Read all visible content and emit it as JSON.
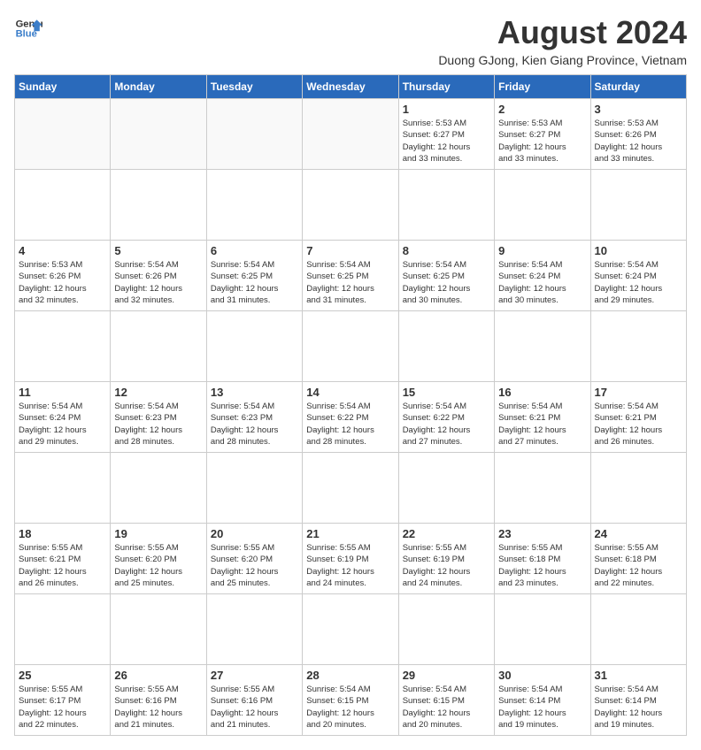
{
  "logo": {
    "line1": "General",
    "line2": "Blue"
  },
  "title": "August 2024",
  "subtitle": "Duong GJong, Kien Giang Province, Vietnam",
  "days_of_week": [
    "Sunday",
    "Monday",
    "Tuesday",
    "Wednesday",
    "Thursday",
    "Friday",
    "Saturday"
  ],
  "weeks": [
    {
      "days": [
        {
          "num": "",
          "info": ""
        },
        {
          "num": "",
          "info": ""
        },
        {
          "num": "",
          "info": ""
        },
        {
          "num": "",
          "info": ""
        },
        {
          "num": "1",
          "info": "Sunrise: 5:53 AM\nSunset: 6:27 PM\nDaylight: 12 hours\nand 33 minutes."
        },
        {
          "num": "2",
          "info": "Sunrise: 5:53 AM\nSunset: 6:27 PM\nDaylight: 12 hours\nand 33 minutes."
        },
        {
          "num": "3",
          "info": "Sunrise: 5:53 AM\nSunset: 6:26 PM\nDaylight: 12 hours\nand 33 minutes."
        }
      ]
    },
    {
      "days": [
        {
          "num": "4",
          "info": "Sunrise: 5:53 AM\nSunset: 6:26 PM\nDaylight: 12 hours\nand 32 minutes."
        },
        {
          "num": "5",
          "info": "Sunrise: 5:54 AM\nSunset: 6:26 PM\nDaylight: 12 hours\nand 32 minutes."
        },
        {
          "num": "6",
          "info": "Sunrise: 5:54 AM\nSunset: 6:25 PM\nDaylight: 12 hours\nand 31 minutes."
        },
        {
          "num": "7",
          "info": "Sunrise: 5:54 AM\nSunset: 6:25 PM\nDaylight: 12 hours\nand 31 minutes."
        },
        {
          "num": "8",
          "info": "Sunrise: 5:54 AM\nSunset: 6:25 PM\nDaylight: 12 hours\nand 30 minutes."
        },
        {
          "num": "9",
          "info": "Sunrise: 5:54 AM\nSunset: 6:24 PM\nDaylight: 12 hours\nand 30 minutes."
        },
        {
          "num": "10",
          "info": "Sunrise: 5:54 AM\nSunset: 6:24 PM\nDaylight: 12 hours\nand 29 minutes."
        }
      ]
    },
    {
      "days": [
        {
          "num": "11",
          "info": "Sunrise: 5:54 AM\nSunset: 6:24 PM\nDaylight: 12 hours\nand 29 minutes."
        },
        {
          "num": "12",
          "info": "Sunrise: 5:54 AM\nSunset: 6:23 PM\nDaylight: 12 hours\nand 28 minutes."
        },
        {
          "num": "13",
          "info": "Sunrise: 5:54 AM\nSunset: 6:23 PM\nDaylight: 12 hours\nand 28 minutes."
        },
        {
          "num": "14",
          "info": "Sunrise: 5:54 AM\nSunset: 6:22 PM\nDaylight: 12 hours\nand 28 minutes."
        },
        {
          "num": "15",
          "info": "Sunrise: 5:54 AM\nSunset: 6:22 PM\nDaylight: 12 hours\nand 27 minutes."
        },
        {
          "num": "16",
          "info": "Sunrise: 5:54 AM\nSunset: 6:21 PM\nDaylight: 12 hours\nand 27 minutes."
        },
        {
          "num": "17",
          "info": "Sunrise: 5:54 AM\nSunset: 6:21 PM\nDaylight: 12 hours\nand 26 minutes."
        }
      ]
    },
    {
      "days": [
        {
          "num": "18",
          "info": "Sunrise: 5:55 AM\nSunset: 6:21 PM\nDaylight: 12 hours\nand 26 minutes."
        },
        {
          "num": "19",
          "info": "Sunrise: 5:55 AM\nSunset: 6:20 PM\nDaylight: 12 hours\nand 25 minutes."
        },
        {
          "num": "20",
          "info": "Sunrise: 5:55 AM\nSunset: 6:20 PM\nDaylight: 12 hours\nand 25 minutes."
        },
        {
          "num": "21",
          "info": "Sunrise: 5:55 AM\nSunset: 6:19 PM\nDaylight: 12 hours\nand 24 minutes."
        },
        {
          "num": "22",
          "info": "Sunrise: 5:55 AM\nSunset: 6:19 PM\nDaylight: 12 hours\nand 24 minutes."
        },
        {
          "num": "23",
          "info": "Sunrise: 5:55 AM\nSunset: 6:18 PM\nDaylight: 12 hours\nand 23 minutes."
        },
        {
          "num": "24",
          "info": "Sunrise: 5:55 AM\nSunset: 6:18 PM\nDaylight: 12 hours\nand 22 minutes."
        }
      ]
    },
    {
      "days": [
        {
          "num": "25",
          "info": "Sunrise: 5:55 AM\nSunset: 6:17 PM\nDaylight: 12 hours\nand 22 minutes."
        },
        {
          "num": "26",
          "info": "Sunrise: 5:55 AM\nSunset: 6:16 PM\nDaylight: 12 hours\nand 21 minutes."
        },
        {
          "num": "27",
          "info": "Sunrise: 5:55 AM\nSunset: 6:16 PM\nDaylight: 12 hours\nand 21 minutes."
        },
        {
          "num": "28",
          "info": "Sunrise: 5:54 AM\nSunset: 6:15 PM\nDaylight: 12 hours\nand 20 minutes."
        },
        {
          "num": "29",
          "info": "Sunrise: 5:54 AM\nSunset: 6:15 PM\nDaylight: 12 hours\nand 20 minutes."
        },
        {
          "num": "30",
          "info": "Sunrise: 5:54 AM\nSunset: 6:14 PM\nDaylight: 12 hours\nand 19 minutes."
        },
        {
          "num": "31",
          "info": "Sunrise: 5:54 AM\nSunset: 6:14 PM\nDaylight: 12 hours\nand 19 minutes."
        }
      ]
    }
  ]
}
